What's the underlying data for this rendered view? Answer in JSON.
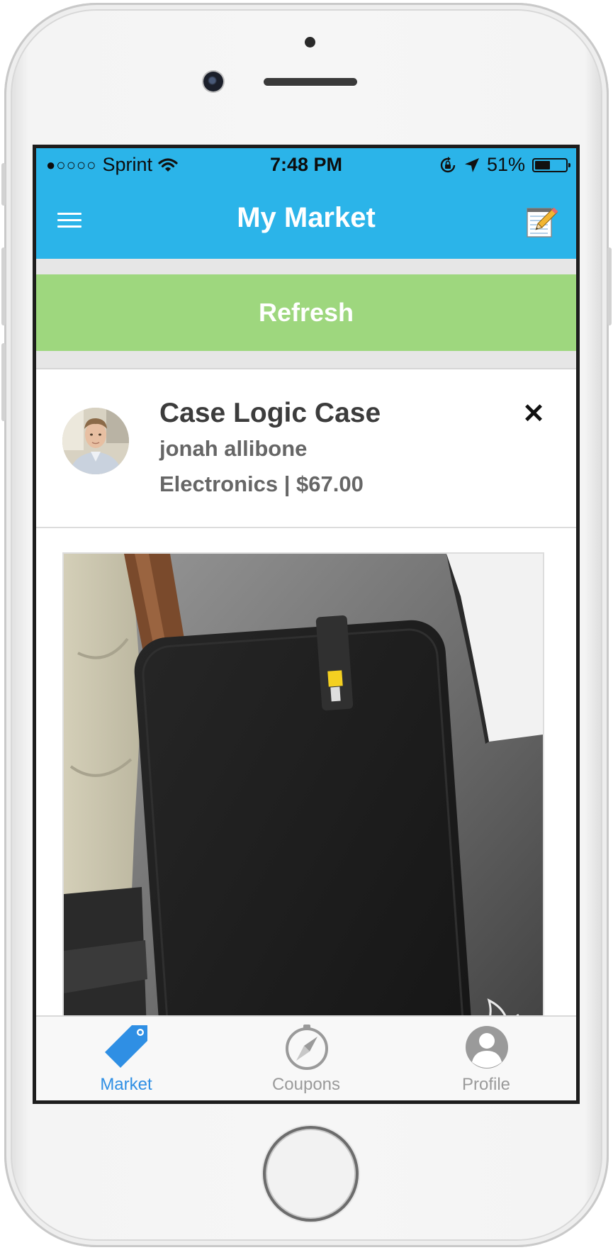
{
  "status_bar": {
    "signal": "●○○○○",
    "carrier": "Sprint",
    "time": "7:48 PM",
    "battery": "51%",
    "battery_level": 0.51
  },
  "nav": {
    "title": "My Market",
    "menu_icon": "hamburger-menu-icon",
    "compose_icon": "notepad-pencil-icon"
  },
  "refresh": {
    "label": "Refresh"
  },
  "listing": {
    "title": "Case Logic Case",
    "seller": "jonah allibone",
    "meta": "Electronics | $67.00",
    "close_label": "✕"
  },
  "tabs": [
    {
      "label": "Market",
      "icon": "price-tag-icon",
      "active": true
    },
    {
      "label": "Coupons",
      "icon": "compass-icon",
      "active": false
    },
    {
      "label": "Profile",
      "icon": "person-icon",
      "active": false
    }
  ],
  "colors": {
    "accent": "#2bb4e9",
    "refresh": "#9ed77e",
    "tab_active": "#2f8fe4",
    "tab_inactive": "#9a9a9a"
  }
}
